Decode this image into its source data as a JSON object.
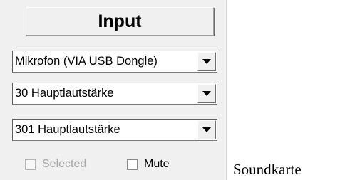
{
  "panel": {
    "input_button": "Input",
    "device_select": {
      "value": "Mikrofon (VIA USB Dongle)"
    },
    "channel_select_1": {
      "value": "30 Hauptlautstärke"
    },
    "channel_select_2": {
      "value": "301 Hauptlautstärke"
    },
    "selected_checkbox": {
      "label": "Selected",
      "checked": false,
      "enabled": false
    },
    "mute_checkbox": {
      "label": "Mute",
      "checked": false,
      "enabled": true
    }
  },
  "caption": "Soundkarte",
  "icons": {
    "dropdown": "chevron-down-icon"
  }
}
